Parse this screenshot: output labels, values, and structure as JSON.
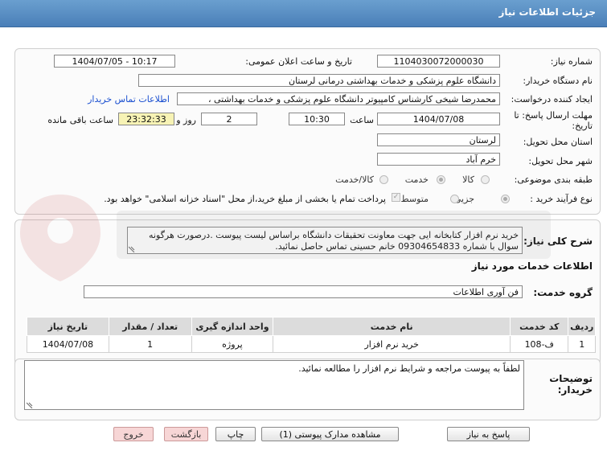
{
  "header": {
    "title": "جزئیات اطلاعات نیاز"
  },
  "info": {
    "need_number_label": "شماره نیاز:",
    "need_number": "1104030072000030",
    "announce_label": "تاریخ و ساعت اعلان عمومی:",
    "announce_value": "1404/07/05 - 10:17",
    "buyer_org_label": "نام دستگاه خریدار:",
    "buyer_org": "دانشگاه علوم پزشکی و خدمات بهداشتی درمانی لرستان",
    "creator_label": "ایجاد کننده درخواست:",
    "creator": "محمدرضا شیخی کارشناس کامپیوتر دانشگاه علوم پزشکی و خدمات بهداشتی ،",
    "contact_link": "اطلاعات تماس خریدار",
    "deadline_label": "مهلت ارسال پاسخ: تا تاریخ:",
    "deadline_date": "1404/07/08",
    "time_label": "ساعت",
    "deadline_time": "10:30",
    "days_value": "2",
    "days_label": "روز و",
    "remaining_time": "23:32:33",
    "remaining_label": "ساعت باقی مانده",
    "province_label": "استان محل تحویل:",
    "province": "لرستان",
    "city_label": "شهر محل تحویل:",
    "city": "خرم آباد",
    "category_label": "طبقه بندی موضوعی:",
    "category_options": [
      "کالا",
      "خدمت",
      "کالا/خدمت"
    ],
    "process_label": "نوع فرآیند خرید :",
    "process_options": [
      "جزیی",
      "متوسط"
    ],
    "payment_text": "پرداخت تمام یا بخشی از مبلغ خرید،از محل \"اسناد خزانه اسلامی\" خواهد بود."
  },
  "summary": {
    "label": "شرح کلی نیاز:",
    "text": "خرید نرم افزار کتابخانه ایی جهت معاونت تحقیقات دانشگاه براساس لیست پیوست .درصورت هرگونه سوال با شماره 09304654833 خانم حسینی تماس حاصل نمائید.",
    "services_heading": "اطلاعات خدمات مورد نیاز",
    "service_group_label": "گروه خدمت:",
    "service_group": "فن آوری اطلاعات"
  },
  "table": {
    "headers": [
      "ردیف",
      "کد خدمت",
      "نام خدمت",
      "واحد اندازه گیری",
      "تعداد / مقدار",
      "تاریخ نیاز"
    ],
    "rows": [
      [
        "1",
        "ف-108",
        "خرید نرم افزار",
        "پروژه",
        "1",
        "1404/07/08"
      ]
    ]
  },
  "buyer_notes": {
    "label": "توضیحات خریدار:",
    "text": "لطفاً به پیوست مراجعه و شرایط نرم افزار را مطالعه نمائید."
  },
  "buttons": {
    "reply": "پاسخ به نیاز",
    "attachments": "مشاهده مدارک پیوستی (1)",
    "print": "چاپ",
    "back": "بازگشت",
    "exit": "خروج"
  },
  "colors": {
    "title_bar": "#5a8fc4",
    "remaining_bg": "#f7f3b5",
    "link": "#1a4fd0"
  }
}
